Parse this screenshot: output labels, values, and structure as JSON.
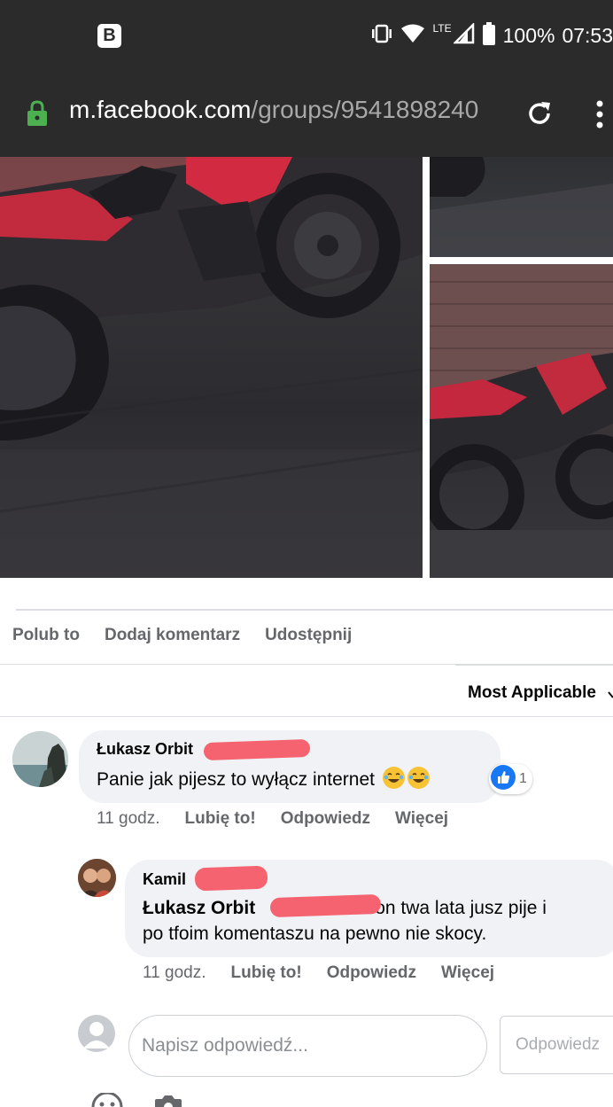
{
  "status_bar": {
    "battery": "100%",
    "time": "07:53",
    "network": "LTE",
    "app_badge": "B"
  },
  "browser": {
    "url_host": "m.facebook.com",
    "url_path": "/groups/9541898240"
  },
  "post_actions": {
    "like": "Polub to",
    "comment": "Dodaj komentarz",
    "share": "Udostępnij"
  },
  "sort_label": "Most Applicable",
  "comments": [
    {
      "author": "Łukasz Orbit",
      "text": "Panie jak pijesz to wyłącz internet",
      "reaction_count": "1",
      "time": "11 godz.",
      "like": "Lubię to!",
      "reply": "Odpowiedz",
      "more": "Więcej"
    },
    {
      "author": "Kamil",
      "mention": "Łukasz Orbit",
      "text_after_mention": "on twa lata jusz pije i",
      "text_line2": "po tfoim komentaszu na pewno nie skocy.",
      "time": "11 godz.",
      "like": "Lubię to!",
      "reply": "Odpowiedz",
      "more": "Więcej"
    }
  ],
  "composer": {
    "placeholder": "Napisz odpowiedź...",
    "submit": "Odpowiedz"
  },
  "colors": {
    "statusbar": "#2b2b2b",
    "lock": "#4caf50",
    "facebook_blue": "#1877f2",
    "redaction": "#f4636f"
  },
  "icons": [
    "app-b-icon",
    "vibrate-icon",
    "wifi-icon",
    "signal-icon",
    "battery-icon",
    "lock-icon",
    "reload-icon",
    "more-vert-icon",
    "laughing-emoji-icon",
    "like-reaction-icon",
    "chevron-down-icon",
    "emoji-picker-icon",
    "camera-icon"
  ]
}
